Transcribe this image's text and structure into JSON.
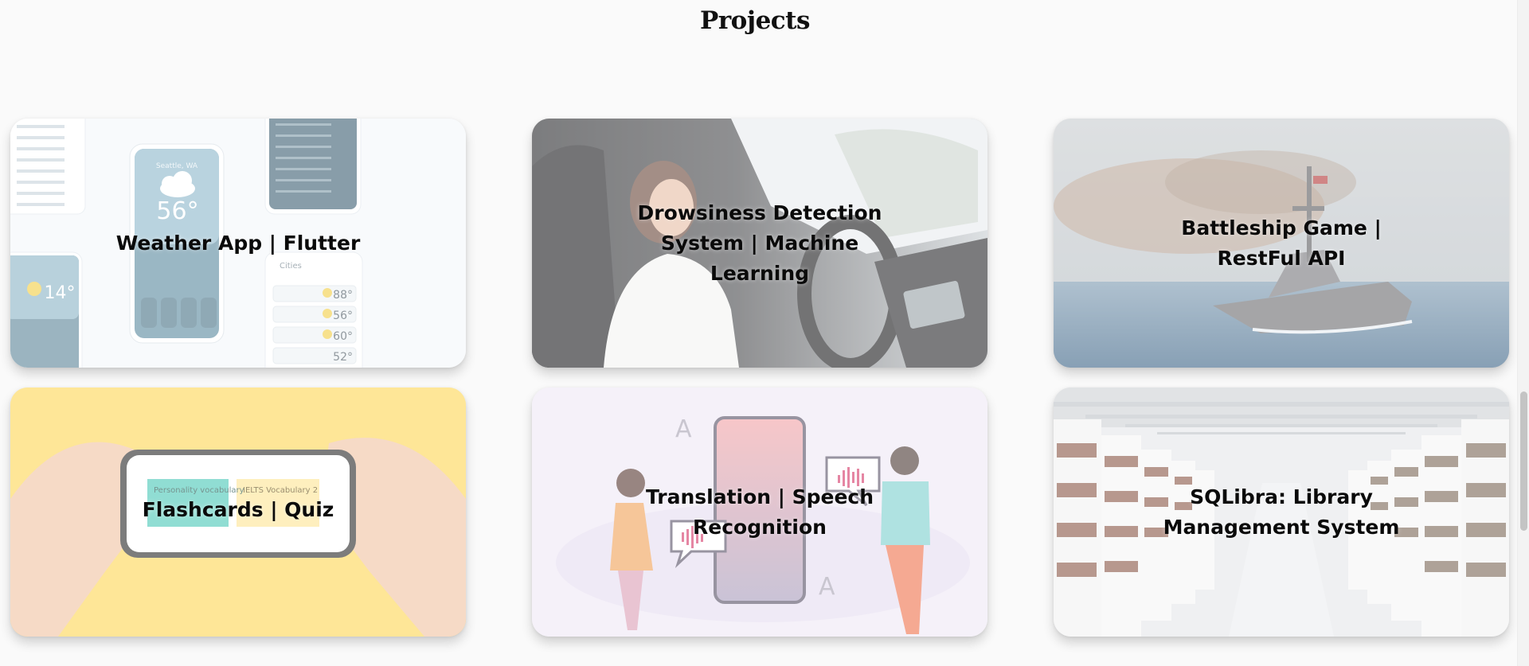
{
  "section": {
    "title": "Projects"
  },
  "projects": [
    {
      "title": "Weather App | Flutter",
      "image_text": {
        "city": "Seattle, WA",
        "temp_main": "56°",
        "temp_small": "14°",
        "cities_heading": "Cities",
        "city_temps": [
          "88°",
          "56°",
          "60°",
          "52°"
        ]
      }
    },
    {
      "title": "Drowsiness Detection System | Machine Learning"
    },
    {
      "title": "Battleship Game | RestFul API"
    },
    {
      "title": "Flashcards | Quiz",
      "image_text": {
        "card1": "Personality vocabulary",
        "card2": "IELTS Vocabulary 2"
      }
    },
    {
      "title": "Translation | Speech Recognition"
    },
    {
      "title": "SQLibra: Library Management System"
    }
  ],
  "colors": {
    "page_bg": "#fafafa",
    "weather_card": "#3f6275",
    "flashcards_bg": "#fdd757",
    "translation_bg": "#efe9f5",
    "library_bg": "#e6e7ea"
  }
}
